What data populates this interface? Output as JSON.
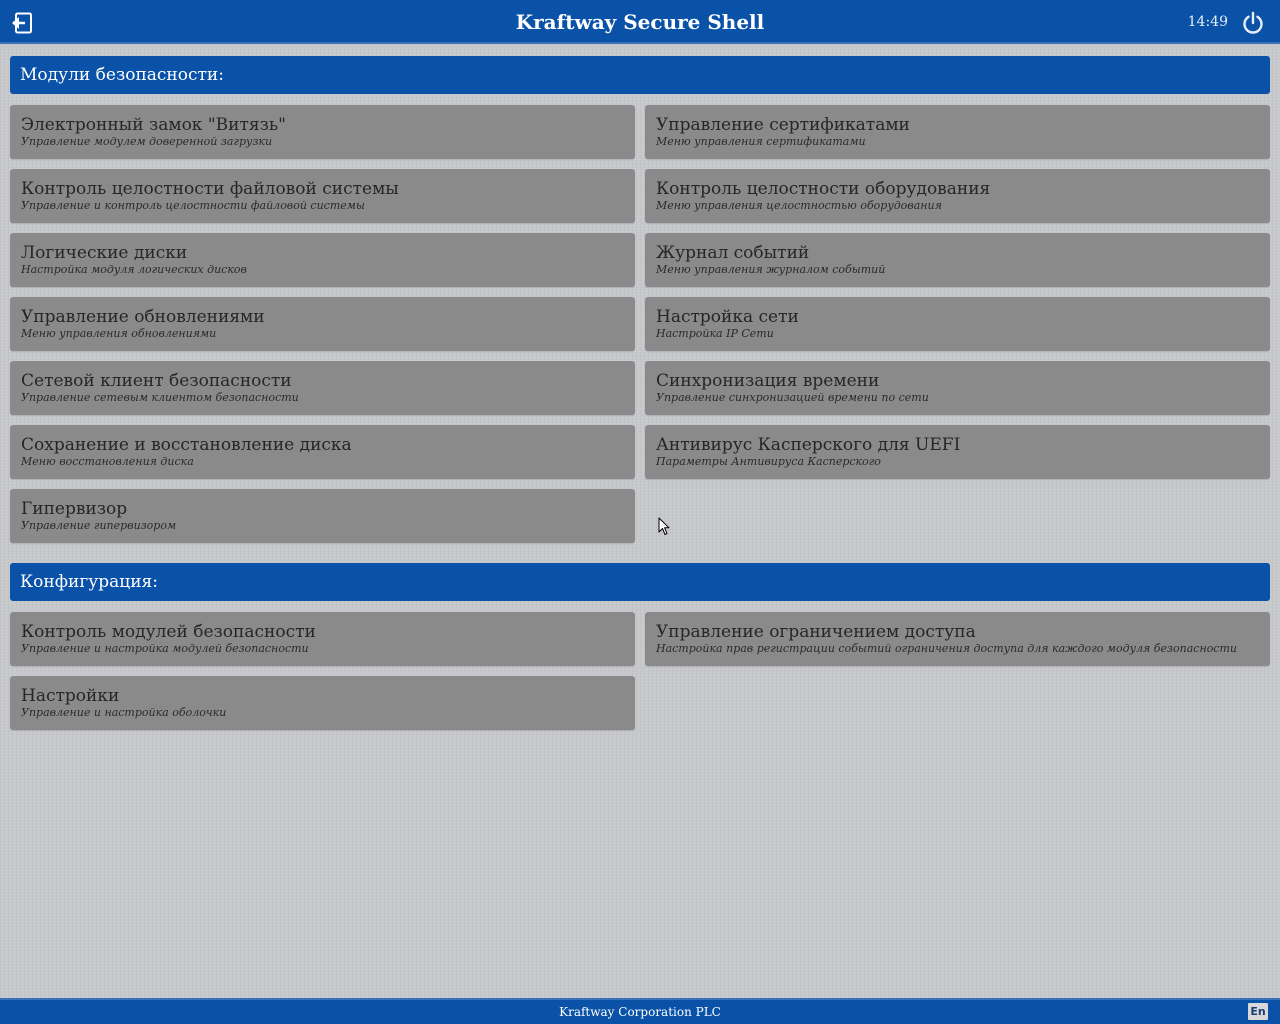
{
  "header": {
    "title": "Kraftway Secure Shell",
    "time": "14:49",
    "logout_icon": "logout-icon",
    "power_icon": "power-icon"
  },
  "sections": {
    "security": {
      "label": "Модули безопасности:",
      "items": [
        {
          "title": "Электронный замок \"Витязь\"",
          "subtitle": "Управление модулем доверенной загрузки"
        },
        {
          "title": "Управление сертификатами",
          "subtitle": "Меню управления сертификатами"
        },
        {
          "title": "Контроль целостности файловой системы",
          "subtitle": "Управление и контроль целостности файловой системы"
        },
        {
          "title": "Контроль целостности оборудования",
          "subtitle": "Меню управления целостностью оборудования"
        },
        {
          "title": "Логические диски",
          "subtitle": "Настройка модуля логических дисков"
        },
        {
          "title": "Журнал событий",
          "subtitle": "Меню управления журналом событий"
        },
        {
          "title": "Управление обновлениями",
          "subtitle": "Меню управления обновлениями"
        },
        {
          "title": "Настройка сети",
          "subtitle": "Настройка IP Сети"
        },
        {
          "title": "Сетевой клиент безопасности",
          "subtitle": "Управление сетевым клиентом безопасности"
        },
        {
          "title": "Синхронизация времени",
          "subtitle": "Управление синхронизацией времени по сети"
        },
        {
          "title": "Сохранение и восстановление диска",
          "subtitle": "Меню восстановления диска"
        },
        {
          "title": "Антивирус Касперского для UEFI",
          "subtitle": "Параметры Антивируса Касперского"
        },
        {
          "title": "Гипервизор",
          "subtitle": "Управление гипервизором"
        }
      ]
    },
    "config": {
      "label": "Конфигурация:",
      "items": [
        {
          "title": "Контроль модулей безопасности",
          "subtitle": "Управление и настройка модулей безопасности"
        },
        {
          "title": "Управление ограничением доступа",
          "subtitle": "Настройка прав регистрации событий ограничения доступа для каждого модуля безопасности"
        },
        {
          "title": "Настройки",
          "subtitle": "Управление и настройка оболочки"
        }
      ]
    }
  },
  "footer": {
    "company": "Kraftway Corporation PLC",
    "language": "En"
  },
  "colors": {
    "bar_blue": "#0a52a8",
    "tile_gray": "#8a8a8a",
    "background": "#c7c8cc"
  }
}
